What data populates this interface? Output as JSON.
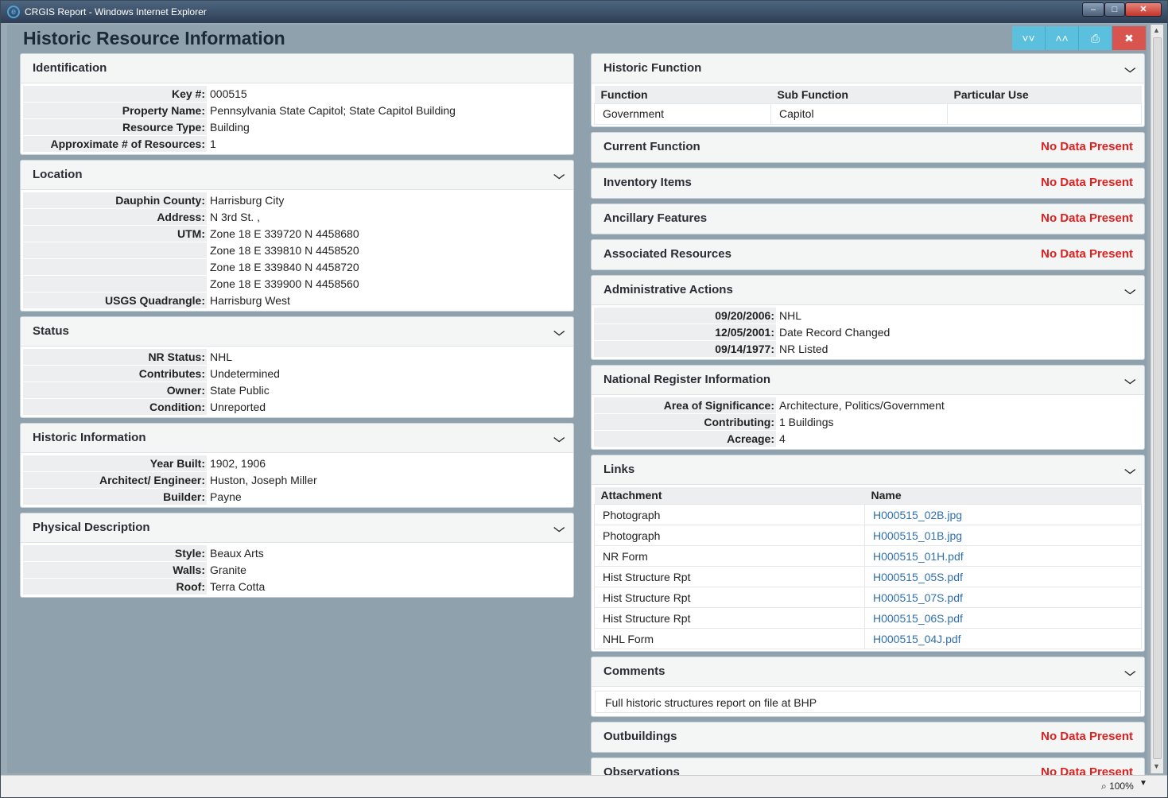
{
  "window": {
    "title": "CRGIS Report - Windows Internet Explorer",
    "zoom": "100%"
  },
  "page": {
    "title": "Historic Resource Information"
  },
  "identification": {
    "title": "Identification",
    "rows": [
      {
        "k": "Key #:",
        "v": "000515"
      },
      {
        "k": "Property Name:",
        "v": "Pennsylvania State Capitol; State Capitol Building"
      },
      {
        "k": "Resource Type:",
        "v": "Building"
      },
      {
        "k": "Approximate # of Resources:",
        "v": "1"
      }
    ]
  },
  "location": {
    "title": "Location",
    "rows": [
      {
        "k": "Dauphin County:",
        "v": "Harrisburg City"
      },
      {
        "k": "Address:",
        "v": "N 3rd St. ,"
      },
      {
        "k": "UTM:",
        "v": "Zone 18 E 339720 N 4458680"
      },
      {
        "k": "",
        "v": "Zone 18 E 339810 N 4458520"
      },
      {
        "k": "",
        "v": "Zone 18 E 339840 N 4458720"
      },
      {
        "k": "",
        "v": "Zone 18 E 339900 N 4458560"
      },
      {
        "k": "USGS Quadrangle:",
        "v": "Harrisburg West"
      }
    ]
  },
  "status": {
    "title": "Status",
    "rows": [
      {
        "k": "NR Status:",
        "v": "NHL"
      },
      {
        "k": "Contributes:",
        "v": "Undetermined"
      },
      {
        "k": "Owner:",
        "v": "State Public"
      },
      {
        "k": "Condition:",
        "v": "Unreported"
      }
    ]
  },
  "historic_info": {
    "title": "Historic Information",
    "rows": [
      {
        "k": "Year Built:",
        "v": "1902, 1906"
      },
      {
        "k": "Architect/ Engineer:",
        "v": "Huston, Joseph Miller"
      },
      {
        "k": "Builder:",
        "v": "Payne"
      }
    ]
  },
  "physical": {
    "title": "Physical Description",
    "rows": [
      {
        "k": "Style:",
        "v": "Beaux Arts"
      },
      {
        "k": "Walls:",
        "v": "Granite"
      },
      {
        "k": "Roof:",
        "v": "Terra Cotta"
      }
    ]
  },
  "historic_function": {
    "title": "Historic Function",
    "headers": [
      "Function",
      "Sub Function",
      "Particular Use"
    ],
    "rows": [
      [
        "Government",
        "Capitol",
        ""
      ]
    ]
  },
  "no_data": "No Data Present",
  "current_function": {
    "title": "Current Function"
  },
  "inventory": {
    "title": "Inventory Items"
  },
  "ancillary": {
    "title": "Ancillary Features"
  },
  "associated": {
    "title": "Associated Resources"
  },
  "admin": {
    "title": "Administrative Actions",
    "rows": [
      {
        "k": "09/20/2006:",
        "v": "NHL"
      },
      {
        "k": "12/05/2001:",
        "v": "Date Record Changed"
      },
      {
        "k": "09/14/1977:",
        "v": "NR Listed"
      }
    ]
  },
  "nr_info": {
    "title": "National Register Information",
    "rows": [
      {
        "k": "Area of Significance:",
        "v": "Architecture, Politics/Government"
      },
      {
        "k": "Contributing:",
        "v": "1 Buildings"
      },
      {
        "k": "Acreage:",
        "v": "4"
      }
    ]
  },
  "links": {
    "title": "Links",
    "headers": [
      "Attachment",
      "Name"
    ],
    "rows": [
      [
        "Photograph",
        "H000515_02B.jpg"
      ],
      [
        "Photograph",
        "H000515_01B.jpg"
      ],
      [
        "NR Form",
        "H000515_01H.pdf"
      ],
      [
        "Hist Structure Rpt",
        "H000515_05S.pdf"
      ],
      [
        "Hist Structure Rpt",
        "H000515_07S.pdf"
      ],
      [
        "Hist Structure Rpt",
        "H000515_06S.pdf"
      ],
      [
        "NHL Form",
        "H000515_04J.pdf"
      ]
    ]
  },
  "comments": {
    "title": "Comments",
    "text": "Full historic structures report on file at BHP"
  },
  "outbuildings": {
    "title": "Outbuildings"
  },
  "observations": {
    "title": "Observations"
  }
}
